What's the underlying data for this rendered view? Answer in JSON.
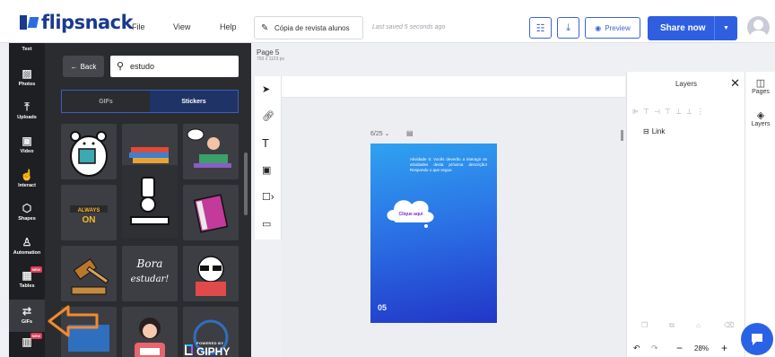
{
  "header": {
    "brand": "flipsnack",
    "menu": [
      "File",
      "View",
      "Help"
    ],
    "doc_name": "Cópia de revista alunos",
    "saved_status": "Last saved 5 seconds ago",
    "preview_label": "Preview",
    "share_label": "Share now"
  },
  "rail": {
    "items": [
      {
        "label": "Text",
        "icon": "text-icon"
      },
      {
        "label": "Photos",
        "icon": "photos-icon"
      },
      {
        "label": "Uploads",
        "icon": "upload-icon"
      },
      {
        "label": "Video",
        "icon": "video-icon"
      },
      {
        "label": "Interact",
        "icon": "interact-icon"
      },
      {
        "label": "Shapes",
        "icon": "shapes-icon"
      },
      {
        "label": "Automation",
        "icon": "automation-icon",
        "badge": "NEW"
      },
      {
        "label": "Tables",
        "icon": "tables-icon",
        "badge": "NEW"
      },
      {
        "label": "GIFs",
        "icon": "gif-icon",
        "active": true
      },
      {
        "label": "",
        "icon": "chart-icon",
        "badge": "NEW"
      }
    ]
  },
  "panel": {
    "back_label": "Back",
    "search_value": "estudo",
    "tabs": [
      {
        "label": "GIFs",
        "selected": false
      },
      {
        "label": "Stickers",
        "selected": true
      }
    ],
    "sticker_texts": {
      "always_on": "ALWAYS ON",
      "bora": "Bora estudar!"
    },
    "giphy_powered": "POWERED BY",
    "giphy_name": "GIPHY"
  },
  "canvas": {
    "page_label": "Page 5",
    "page_size": "793 x 1123 px",
    "page_counter": "6/25",
    "page_text": "Atividade 5: Vocês deverão a interagir as atividades desta próxima descrição! Respondo o que segue.",
    "cloud_text": "Clique aqui",
    "page_number": "05"
  },
  "layers": {
    "title": "Layers",
    "items": [
      {
        "label": "Link",
        "icon": "link-layer-icon"
      }
    ],
    "zoom": "28%"
  },
  "right_tabs": [
    {
      "label": "Pages",
      "icon": "pages-icon"
    },
    {
      "label": "Layers",
      "icon": "layers-icon"
    }
  ],
  "colors": {
    "accent": "#2f5fe0",
    "brand": "#1a3a8f",
    "arrow": "#f28a2e"
  }
}
